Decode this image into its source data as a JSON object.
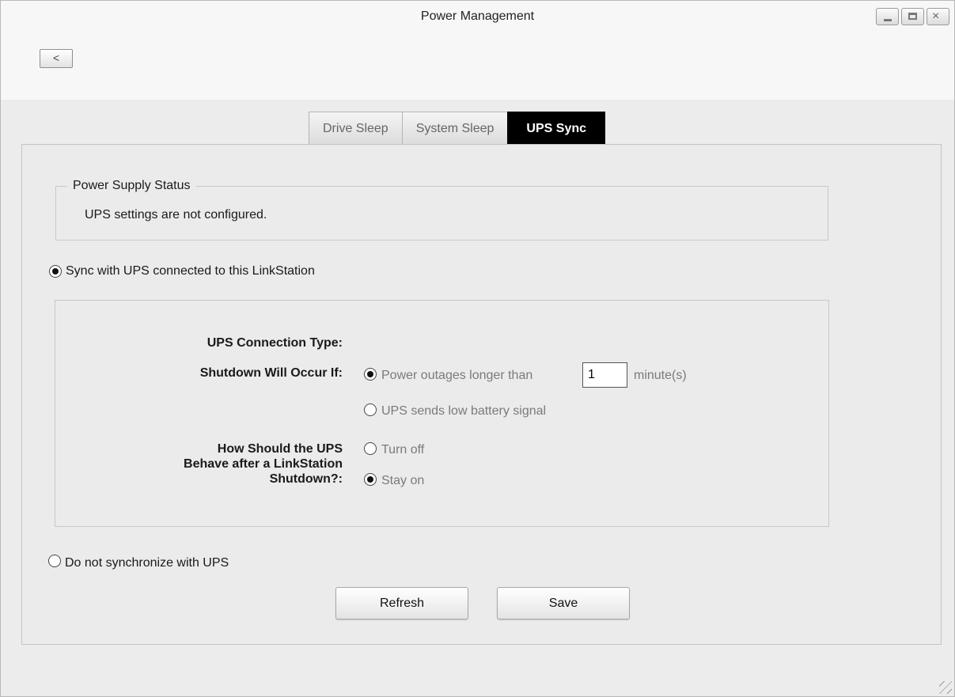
{
  "window": {
    "title": "Power Management",
    "back_label": "<",
    "close_label": "×"
  },
  "tabs": [
    {
      "label": "Drive Sleep",
      "active": false
    },
    {
      "label": "System Sleep",
      "active": false
    },
    {
      "label": "UPS Sync",
      "active": true
    }
  ],
  "power_supply_status": {
    "legend": "Power Supply Status",
    "text": "UPS settings are not configured."
  },
  "sync_mode": {
    "sync_label": "Sync with UPS connected to this LinkStation",
    "sync_selected": true,
    "nosync_label": "Do not synchronize with UPS",
    "nosync_selected": false
  },
  "ups_settings": {
    "connection_type_label": "UPS Connection Type:",
    "shutdown_label": "Shutdown Will Occur If:",
    "shutdown_options": [
      {
        "label": "Power outages longer than",
        "selected": true
      },
      {
        "label": "UPS sends low battery signal",
        "selected": false
      }
    ],
    "minutes_value": "1",
    "minutes_unit": "minute(s)",
    "behave_label_lines": [
      "How Should the UPS",
      "Behave after a LinkStation",
      "Shutdown?:"
    ],
    "behave_options": [
      {
        "label": "Turn off",
        "selected": false
      },
      {
        "label": "Stay on",
        "selected": true
      }
    ]
  },
  "buttons": {
    "refresh": "Refresh",
    "save": "Save"
  },
  "colors": {
    "active_tab_bg": "#000000",
    "active_tab_text": "#ffffff",
    "panel_bg": "#ebebeb"
  }
}
